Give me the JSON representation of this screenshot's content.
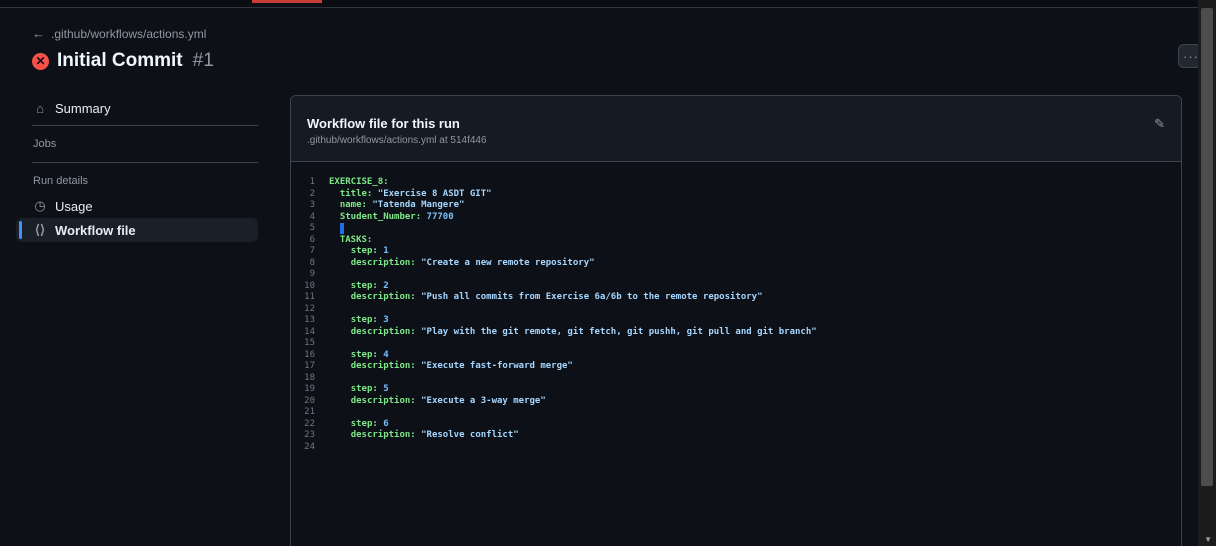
{
  "header": {
    "back_link": ".github/workflows/actions.yml",
    "run_title": "Initial Commit",
    "run_number": "#1",
    "more_label": "···"
  },
  "sidebar": {
    "summary": "Summary",
    "jobs_heading": "Jobs",
    "run_details_heading": "Run details",
    "usage": "Usage",
    "workflow_file": "Workflow file"
  },
  "panel": {
    "title": "Workflow file for this run",
    "subtitle": ".github/workflows/actions.yml at 514f446"
  },
  "code_lines": [
    {
      "n": "1",
      "indent": "",
      "key": "EXERCISE_8:",
      "value": "",
      "vtype": ""
    },
    {
      "n": "2",
      "indent": "  ",
      "key": "title:",
      "value": " \"Exercise 8 ASDT GIT\"",
      "vtype": "s"
    },
    {
      "n": "3",
      "indent": "  ",
      "key": "name:",
      "value": " \"Tatenda Mangere\"",
      "vtype": "s"
    },
    {
      "n": "4",
      "indent": "  ",
      "key": "Student_Number:",
      "value": " 77700",
      "vtype": "n"
    },
    {
      "n": "5",
      "indent": "  ",
      "key": "",
      "value": "",
      "vtype": "cursor"
    },
    {
      "n": "6",
      "indent": "  ",
      "key": "TASKS:",
      "value": "",
      "vtype": ""
    },
    {
      "n": "7",
      "indent": "    ",
      "key": "step:",
      "value": " 1",
      "vtype": "n"
    },
    {
      "n": "8",
      "indent": "    ",
      "key": "description:",
      "value": " \"Create a new remote repository\"",
      "vtype": "s"
    },
    {
      "n": "9",
      "indent": "",
      "key": "",
      "value": "",
      "vtype": ""
    },
    {
      "n": "10",
      "indent": "    ",
      "key": "step:",
      "value": " 2",
      "vtype": "n"
    },
    {
      "n": "11",
      "indent": "    ",
      "key": "description:",
      "value": " \"Push all commits from Exercise 6a/6b to the remote repository\"",
      "vtype": "s"
    },
    {
      "n": "12",
      "indent": "",
      "key": "",
      "value": "",
      "vtype": ""
    },
    {
      "n": "13",
      "indent": "    ",
      "key": "step:",
      "value": " 3",
      "vtype": "n"
    },
    {
      "n": "14",
      "indent": "    ",
      "key": "description:",
      "value": " \"Play with the git remote, git fetch, git pushh, git pull and git branch\"",
      "vtype": "s"
    },
    {
      "n": "15",
      "indent": "",
      "key": "",
      "value": "",
      "vtype": ""
    },
    {
      "n": "16",
      "indent": "    ",
      "key": "step:",
      "value": " 4",
      "vtype": "n"
    },
    {
      "n": "17",
      "indent": "    ",
      "key": "description:",
      "value": " \"Execute fast-forward merge\"",
      "vtype": "s"
    },
    {
      "n": "18",
      "indent": "",
      "key": "",
      "value": "",
      "vtype": ""
    },
    {
      "n": "19",
      "indent": "    ",
      "key": "step:",
      "value": " 5",
      "vtype": "n"
    },
    {
      "n": "20",
      "indent": "    ",
      "key": "description:",
      "value": " \"Execute a 3-way merge\"",
      "vtype": "s"
    },
    {
      "n": "21",
      "indent": "",
      "key": "",
      "value": "",
      "vtype": ""
    },
    {
      "n": "22",
      "indent": "    ",
      "key": "step:",
      "value": " 6",
      "vtype": "n"
    },
    {
      "n": "23",
      "indent": "    ",
      "key": "description:",
      "value": " \"Resolve conflict\"",
      "vtype": "s"
    },
    {
      "n": "24",
      "indent": "",
      "key": "",
      "value": "",
      "vtype": ""
    }
  ],
  "colors": {
    "background": "#0d1117",
    "fail": "#f85149",
    "active_accent": "#4493f8",
    "yaml_key": "#7ee787",
    "yaml_string": "#a5d6ff"
  },
  "icons": {
    "back": "arrow-left-icon",
    "status": "x-circle-fill-icon",
    "summary": "home-icon",
    "usage": "stopwatch-icon",
    "workflow_file": "file-code-icon",
    "edit": "pencil-icon",
    "more": "kebab-horizontal-icon"
  }
}
